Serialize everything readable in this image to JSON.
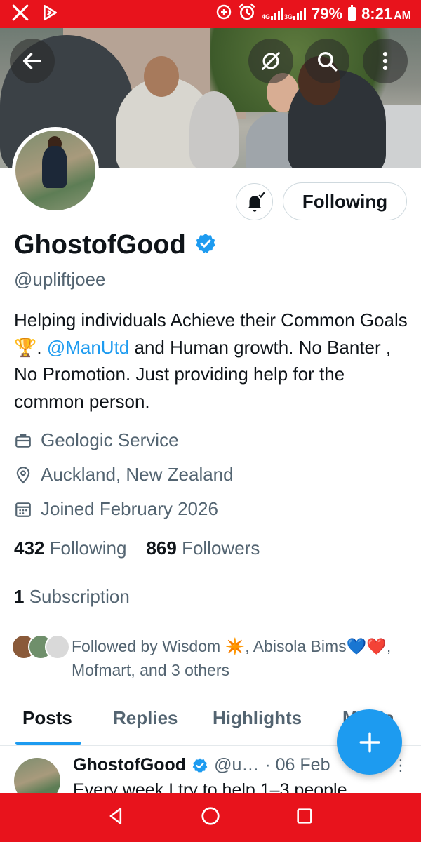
{
  "status_bar": {
    "time": "8:21",
    "ampm": "AM",
    "battery": "79%",
    "net_1": "4G",
    "net_2": "3G",
    "left_icons": [
      "x-app-icon",
      "play-icon"
    ],
    "right_icons": [
      "data-saver-icon",
      "alarm-icon",
      "signal-icon",
      "battery-icon"
    ]
  },
  "profile": {
    "display_name": "GhostofGood",
    "verified": true,
    "handle": "@upliftjoee",
    "bio_part1": "Helping individuals Achieve their Common Goals 🏆. ",
    "bio_mention": "@ManUtd",
    "bio_part2": " and Human growth. No Banter , No Promotion. Just providing help for the common person.",
    "profession": "Geologic Service",
    "location": "Auckland, New Zealand",
    "joined": "Joined February 2026",
    "following_count": "432",
    "following_label": "Following",
    "followers_count": "869",
    "followers_label": "Followers",
    "subscription_count": "1",
    "subscription_label": "Subscription",
    "followed_by": "Followed by Wisdom ✴️, Abisola Bims💙❤️, Mofmart, and 3 others"
  },
  "actions": {
    "follow_label": "Following"
  },
  "tabs": [
    {
      "label": "Posts",
      "active": true
    },
    {
      "label": "Replies",
      "active": false
    },
    {
      "label": "Highlights",
      "active": false
    },
    {
      "label": "Media",
      "active": false
    }
  ],
  "post": {
    "name": "GhostofGood",
    "handle": "@u…",
    "date": "· 06 Feb",
    "text": "Every week I try to help 1–3 people"
  },
  "colors": {
    "accent": "#1d9bf0",
    "system_bar": "#e8131c",
    "secondary_text": "#536471"
  }
}
